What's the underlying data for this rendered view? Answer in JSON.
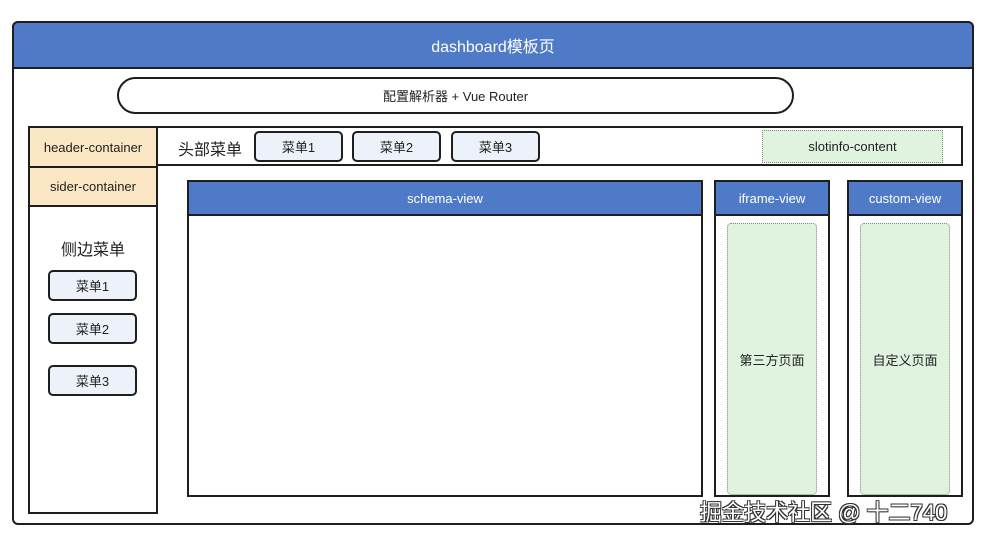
{
  "dashboard": {
    "title": "dashboard模板页"
  },
  "parser": {
    "label": "配置解析器 + Vue Router"
  },
  "sidebar": {
    "header_container_label": "header-container",
    "sider_container_label": "sider-container",
    "menu_title": "侧边菜单",
    "items": [
      {
        "label": "菜单1"
      },
      {
        "label": "菜单2"
      },
      {
        "label": "菜单3"
      }
    ]
  },
  "header": {
    "menu_title": "头部菜单",
    "items": [
      {
        "label": "菜单1"
      },
      {
        "label": "菜单2"
      },
      {
        "label": "菜单3"
      }
    ],
    "slotinfo_label": "slotinfo-content"
  },
  "views": {
    "schema": {
      "title": "schema-view"
    },
    "iframe": {
      "title": "iframe-view",
      "content": "第三方页面"
    },
    "custom": {
      "title": "custom-view",
      "content": "自定义页面"
    }
  },
  "watermark": {
    "text": "掘金技术社区 @ 十二740"
  },
  "colors": {
    "title_bar": "#4f7ac7",
    "container_label": "#fbe7c4",
    "menu_button": "#edf1fa",
    "placeholder_fill": "#dff3df",
    "border": "#1e1e1e"
  }
}
